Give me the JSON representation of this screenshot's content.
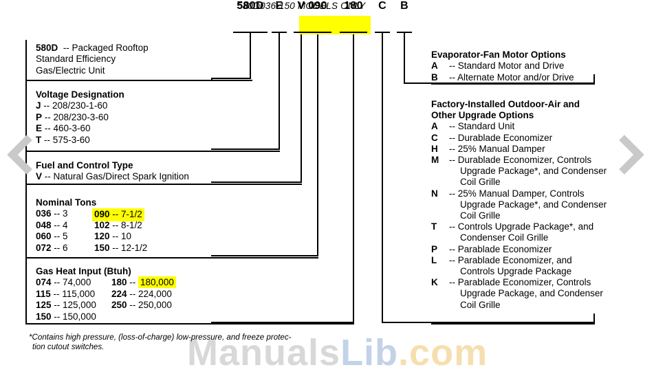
{
  "header": {
    "models_only": "580D036-150 MODELS ONLY"
  },
  "model_code": {
    "segments": [
      {
        "text": "580D",
        "highlighted": false
      },
      {
        "text": "E",
        "highlighted": false
      },
      {
        "text": "V",
        "highlighted": false
      },
      {
        "text": "090",
        "highlighted": true
      },
      {
        "text": "180",
        "highlighted": true
      },
      {
        "text": "C",
        "highlighted": false
      },
      {
        "text": "B",
        "highlighted": false
      }
    ]
  },
  "left_sections": {
    "unit_type": {
      "lines": [
        "580D  -- Packaged Rooftop",
        "Standard Efficiency",
        "Gas/Electric Unit"
      ],
      "code": "580D",
      "desc": "-- Packaged Rooftop"
    },
    "voltage": {
      "title": "Voltage Designation",
      "items": [
        {
          "code": "J",
          "value": "208/230-1-60"
        },
        {
          "code": "P",
          "value": "208/230-3-60"
        },
        {
          "code": "E",
          "value": "460-3-60"
        },
        {
          "code": "T",
          "value": "575-3-60"
        }
      ]
    },
    "fuel": {
      "title": "Fuel and Control Type",
      "items": [
        {
          "code": "V",
          "value": "Natural Gas/Direct Spark Ignition"
        }
      ]
    },
    "nominal_tons": {
      "title": "Nominal Tons",
      "rows": [
        {
          "left_code": "036",
          "left_value": "3",
          "right_code": "090",
          "right_value": "7-1/2",
          "right_highlighted": true
        },
        {
          "left_code": "048",
          "left_value": "4",
          "right_code": "102",
          "right_value": "8-1/2",
          "right_highlighted": false
        },
        {
          "left_code": "060",
          "left_value": "5",
          "right_code": "120",
          "right_value": "10",
          "right_highlighted": false
        },
        {
          "left_code": "072",
          "left_value": "6",
          "right_code": "150",
          "right_value": "12-1/2",
          "right_highlighted": false
        }
      ]
    },
    "gas_heat": {
      "title": "Gas Heat Input (Btuh)",
      "rows": [
        {
          "left_code": "074",
          "left_value": "74,000",
          "right_code": "180",
          "right_value": "180,000",
          "right_highlighted": true
        },
        {
          "left_code": "115",
          "left_value": "115,000",
          "right_code": "224",
          "right_value": "224,000",
          "right_highlighted": false
        },
        {
          "left_code": "125",
          "left_value": "125,000",
          "right_code": "250",
          "right_value": "250,000",
          "right_highlighted": false
        },
        {
          "left_code": "150",
          "left_value": "150,000",
          "right_code": "",
          "right_value": "",
          "right_highlighted": false
        }
      ]
    }
  },
  "right_sections": {
    "evap_fan": {
      "title": "Evaporator-Fan Motor Options",
      "items": [
        {
          "code": "A",
          "lines": [
            "Standard Motor and Drive"
          ]
        },
        {
          "code": "B",
          "lines": [
            "Alternate Motor and/or Drive"
          ]
        }
      ]
    },
    "factory": {
      "title_line1": "Factory-Installed Outdoor-Air and",
      "title_line2": "Other Upgrade Options",
      "items": [
        {
          "code": "A",
          "lines": [
            "Standard Unit"
          ]
        },
        {
          "code": "C",
          "lines": [
            "Durablade Economizer"
          ]
        },
        {
          "code": "H",
          "lines": [
            "25% Manual Damper"
          ]
        },
        {
          "code": "M",
          "lines": [
            "Durablade Economizer, Controls",
            "Upgrade Package*, and Condenser",
            "Coil Grille"
          ]
        },
        {
          "code": "N",
          "lines": [
            "25% Manual Damper, Controls",
            "Upgrade Package*, and Condenser",
            "Coil Grille"
          ]
        },
        {
          "code": "T",
          "lines": [
            "Controls Upgrade Package*, and",
            "Condenser Coil Grille"
          ]
        },
        {
          "code": "P",
          "lines": [
            "Parablade Economizer"
          ]
        },
        {
          "code": "L",
          "lines": [
            "Parablade Economizer, and",
            "Controls Upgrade Package"
          ]
        },
        {
          "code": "K",
          "lines": [
            "Parablade Economizer, Controls",
            "Upgrade Package, and Condenser",
            "Coil Grille"
          ]
        }
      ]
    }
  },
  "footnote": {
    "line1": "*Contains high pressure, (loss-of-charge) low-pressure, and freeze protec-",
    "line2": "tion cutout switches."
  },
  "watermark": {
    "part1": "Manuals",
    "part2": "Lib",
    "part3": ".com"
  },
  "nav": {
    "prev_label": "Previous page",
    "next_label": "Next page"
  },
  "colors": {
    "highlight": "#ffff00",
    "line": "#000000",
    "chevron": "#c9c9c9"
  }
}
